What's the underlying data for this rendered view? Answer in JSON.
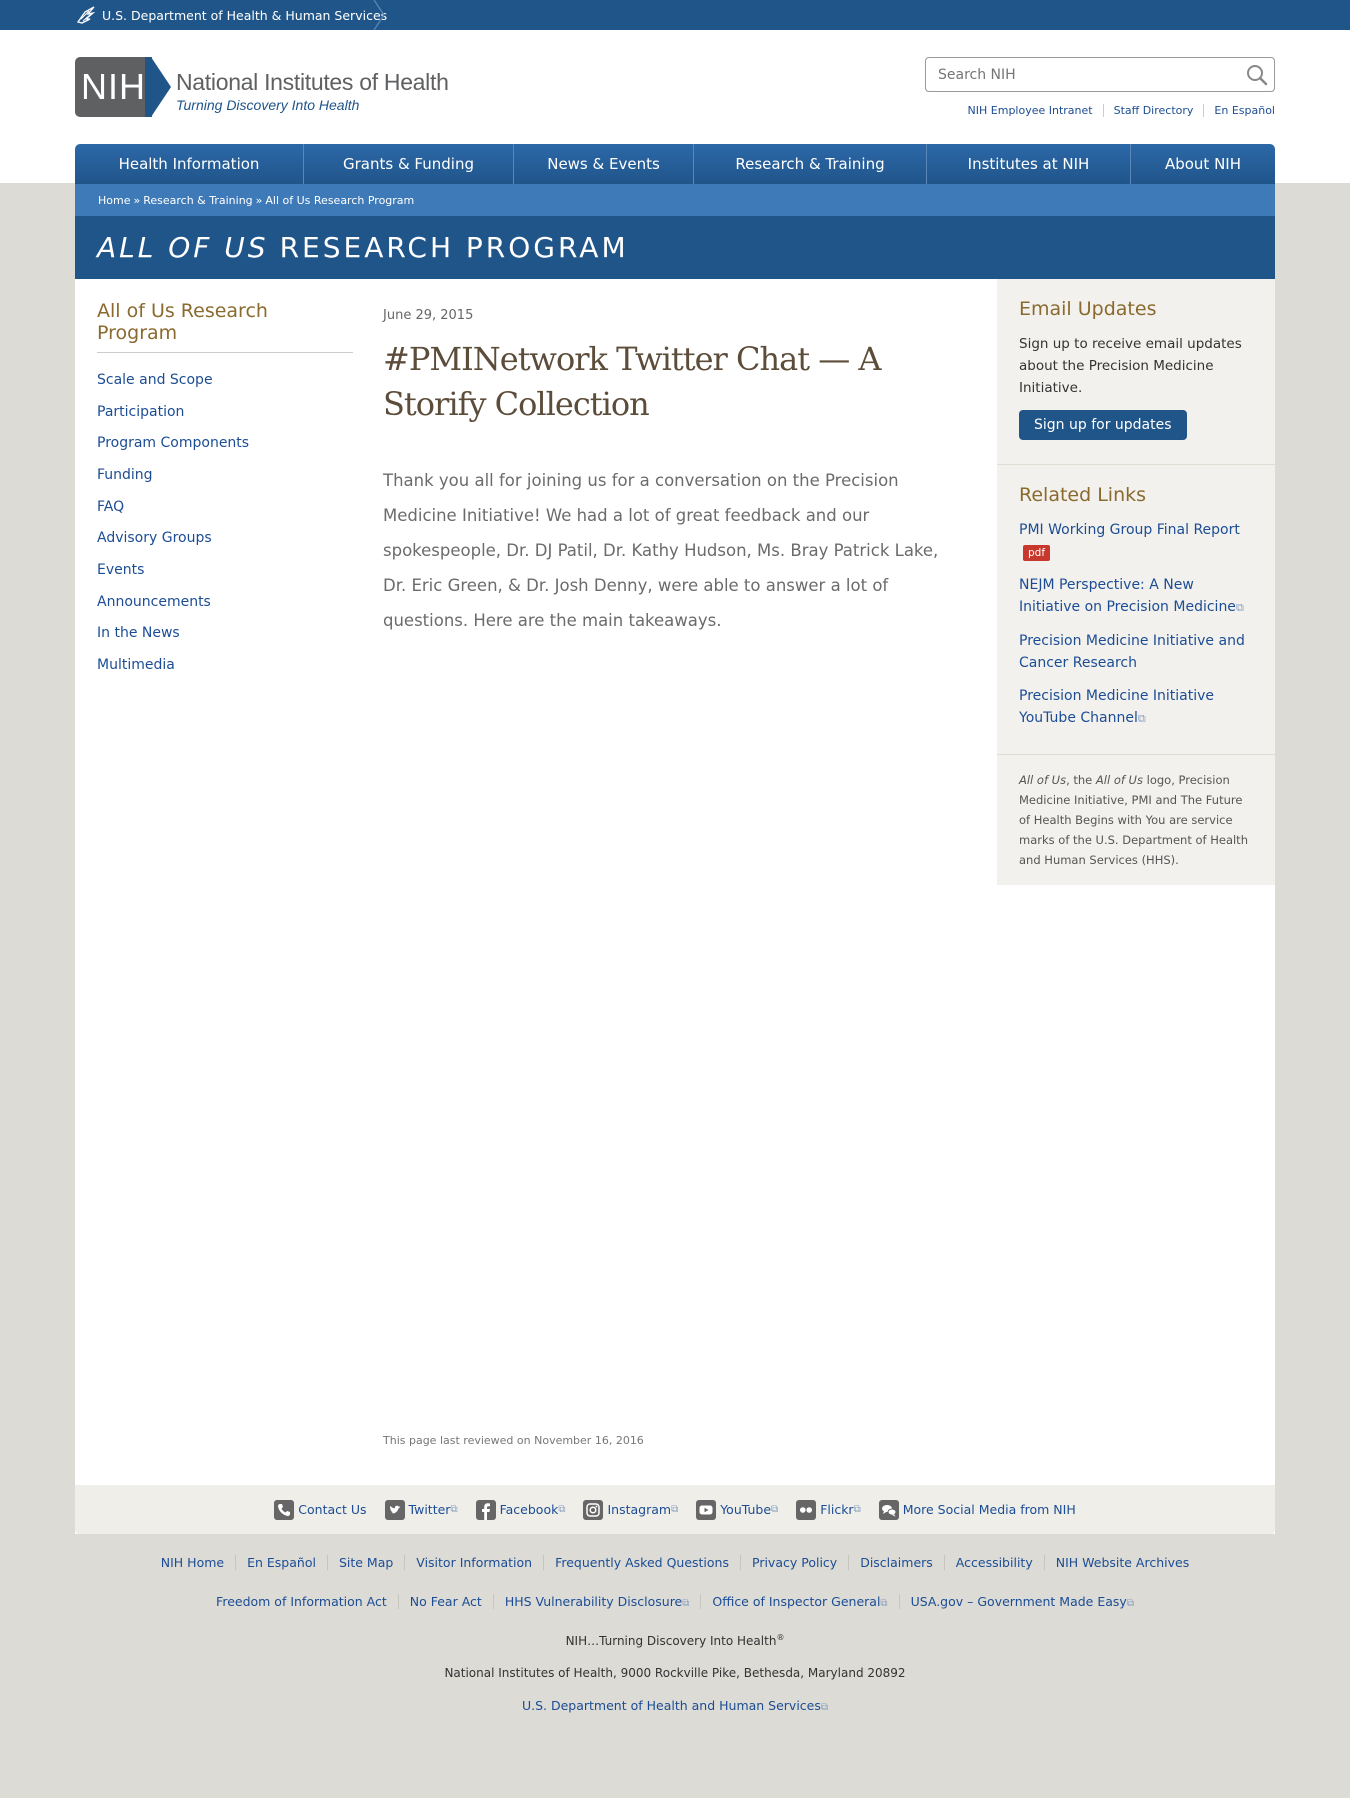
{
  "hhs_bar": {
    "label": "U.S. Department of Health & Human Services"
  },
  "logo": {
    "mark_text": "NIH",
    "name": "National Institutes of Health",
    "tagline": "Turning Discovery Into Health"
  },
  "search": {
    "placeholder": "Search NIH"
  },
  "utility_links": [
    "NIH Employee Intranet",
    "Staff Directory",
    "En Español"
  ],
  "nav": [
    "Health Information",
    "Grants & Funding",
    "News & Events",
    "Research & Training",
    "Institutes at NIH",
    "About NIH"
  ],
  "breadcrumb": [
    "Home",
    "Research & Training",
    "All of Us Research Program"
  ],
  "banner": {
    "italic": "ALL OF US",
    "rest": "RESEARCH PROGRAM"
  },
  "left_nav": {
    "title": "All of Us Research Program",
    "items": [
      "Scale and Scope",
      "Participation",
      "Program Components",
      "Funding",
      "FAQ",
      "Advisory Groups",
      "Events",
      "Announcements",
      "In the News",
      "Multimedia"
    ]
  },
  "article": {
    "date": "June 29, 2015",
    "title": "#PMINetwork Twitter Chat — A Storify Collection",
    "body": "Thank you all for joining us for a conversation on the Precision Medicine Initiative! We had a lot of great feedback and our spokespeople, Dr. DJ Patil, Dr. Kathy Hudson, Ms. Bray Patrick Lake, Dr. Eric Green, & Dr. Josh Denny, were able to answer a lot of questions. Here are the main takeaways.",
    "reviewed": "This page last reviewed on November 16, 2016"
  },
  "sidebar": {
    "email_title": "Email Updates",
    "email_text": "Sign up to receive email updates about the Precision Medicine Initiative.",
    "signup_label": "Sign up for updates",
    "related_title": "Related Links",
    "links": {
      "l1": "PMI Working Group Final Report",
      "pdf": "pdf",
      "l2": "NEJM Perspective: A New Initiative on Precision Medicine",
      "l3": "Precision Medicine Initiative and Cancer Research",
      "l4": "Precision Medicine Initiative YouTube Channel"
    },
    "legal": {
      "i1": "All of Us",
      "t1": ", the ",
      "i2": "All of Us",
      "t2": " logo, Precision Medicine Initiative, PMI and The Future of Health Begins with You are service marks of the U.S. Department of Health and Human Services (HHS)."
    }
  },
  "social": [
    "Contact Us",
    "Twitter",
    "Facebook",
    "Instagram",
    "YouTube",
    "Flickr",
    "More Social Media from NIH"
  ],
  "footer": {
    "row1": [
      "NIH Home",
      "En Español",
      "Site Map",
      "Visitor Information",
      "Frequently Asked Questions",
      "Privacy Policy",
      "Disclaimers",
      "Accessibility",
      "NIH Website Archives"
    ],
    "row2": [
      "Freedom of Information Act",
      "No Fear Act",
      "HHS Vulnerability Disclosure",
      "Office of Inspector General",
      "USA.gov – Government Made Easy"
    ],
    "motto": "NIH…Turning Discovery Into Health",
    "motto_mark": "®",
    "address": "National Institutes of Health, 9000 Rockville Pike, Bethesda, Maryland 20892",
    "hhs_link": "U.S. Department of Health and Human Services"
  },
  "colors": {
    "brand_blue": "#20558a",
    "breadcrumb_blue": "#3e7ab8",
    "heading_gold": "#8a6a2e",
    "link": "#1c4d94",
    "pdf_red": "#c8382d"
  },
  "icons": [
    "hhs-eagle-icon",
    "search-icon",
    "external-link-icon",
    "phone-icon",
    "twitter-icon",
    "facebook-icon",
    "instagram-icon",
    "youtube-icon",
    "flickr-icon",
    "chat-bubbles-icon"
  ]
}
